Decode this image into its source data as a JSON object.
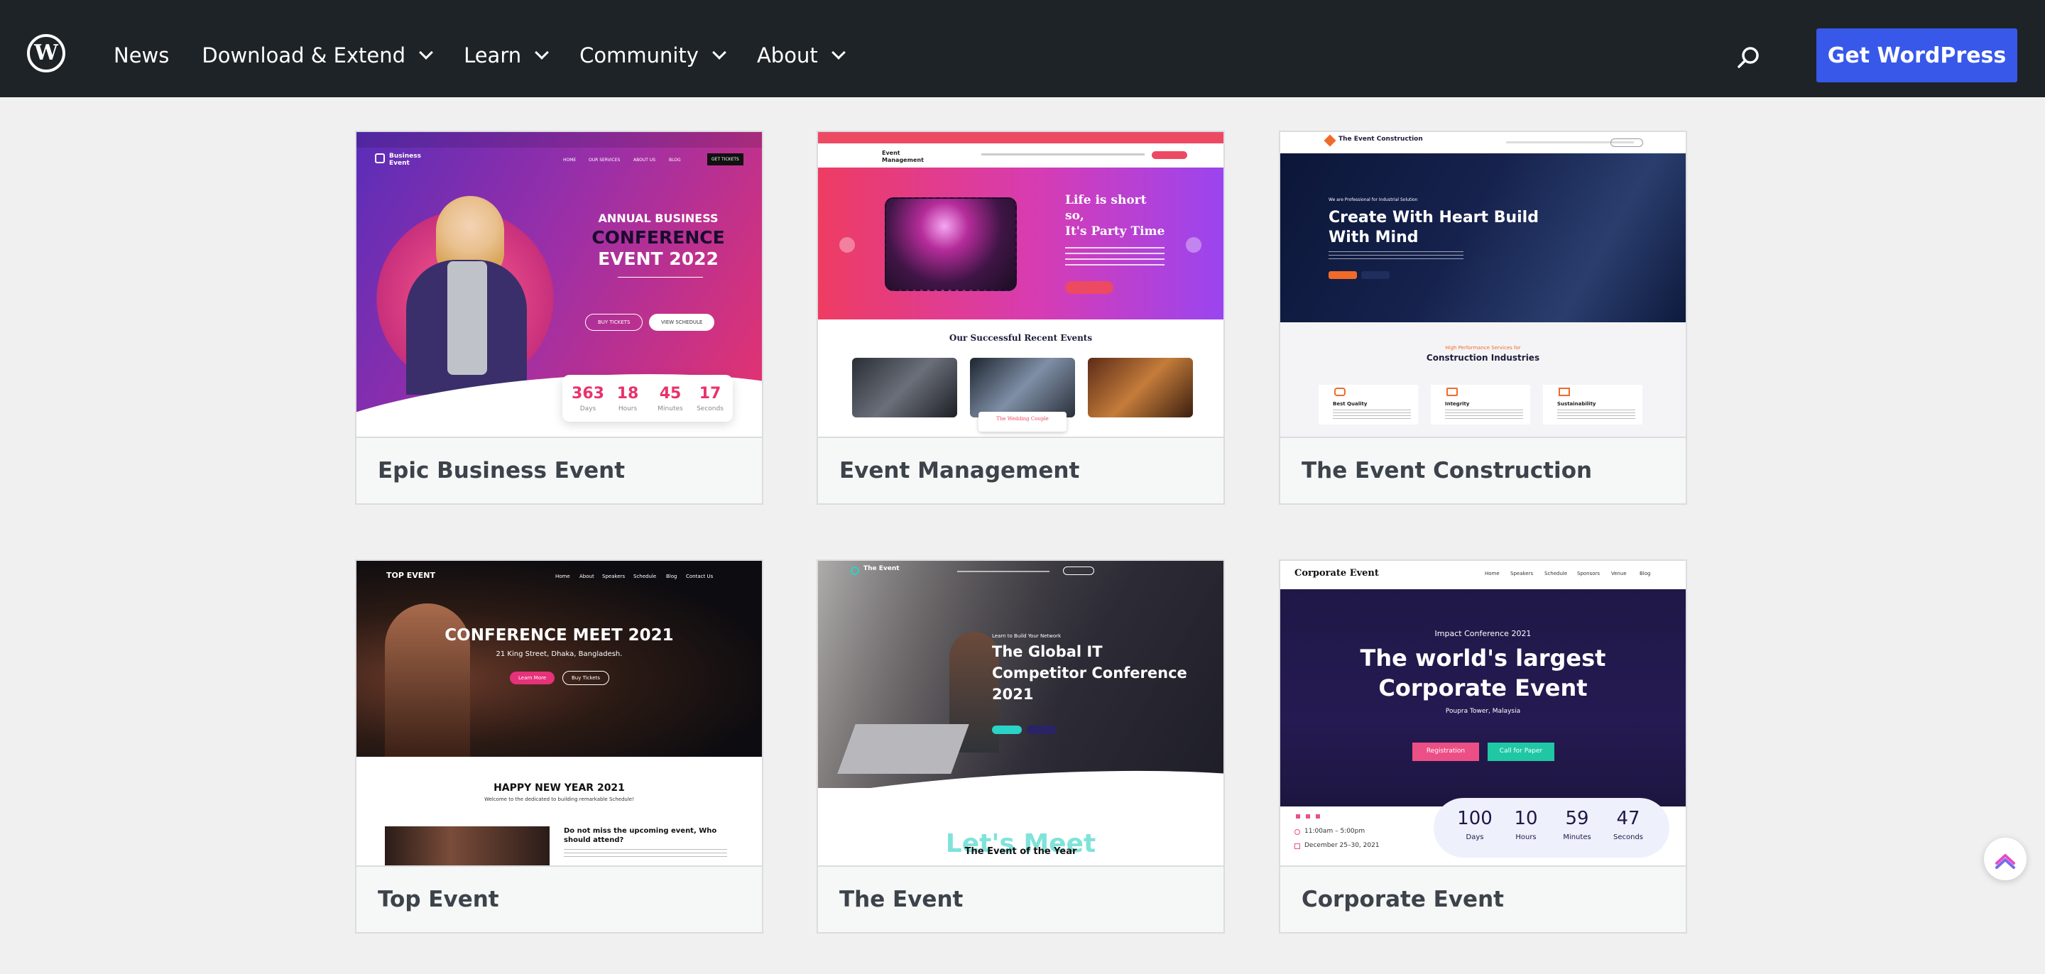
{
  "header": {
    "logo_letter": "W",
    "nav": [
      {
        "label": "News",
        "dropdown": false
      },
      {
        "label": "Download & Extend",
        "dropdown": true
      },
      {
        "label": "Learn",
        "dropdown": true
      },
      {
        "label": "Community",
        "dropdown": true
      },
      {
        "label": "About",
        "dropdown": true
      }
    ],
    "cta_label": "Get WordPress",
    "search_icon": "search-icon",
    "colors": {
      "bar": "#1d2327",
      "cta": "#3858e9"
    }
  },
  "cards": [
    {
      "title": "Epic Business Event",
      "preview": {
        "logo": "Business Event",
        "menu": [
          "HOME",
          "OUR SERVICES",
          "ABOUT US",
          "BLOG"
        ],
        "button": "GET TICKETS",
        "kicker": "ANNUAL BUSINESS",
        "headline": [
          "CONFERENCE",
          "EVENT 2022"
        ],
        "buttons": [
          "BUY TICKETS",
          "VIEW SCHEDULE"
        ],
        "countdown": [
          {
            "value": "363",
            "label": "Days"
          },
          {
            "value": "18",
            "label": "Hours"
          },
          {
            "value": "45",
            "label": "Minutes"
          },
          {
            "value": "17",
            "label": "Seconds"
          }
        ]
      }
    },
    {
      "title": "Event Management",
      "preview": {
        "logo": "Event Management",
        "headline": [
          "Life is short",
          "so,",
          "It's Party Time"
        ],
        "section_title": "Our Successful Recent Events",
        "caption": "The Wedding Couple"
      }
    },
    {
      "title": "The Event Construction",
      "preview": {
        "logo": "The Event Construction",
        "kicker": "We are Professional for Industrial Solution",
        "headline": [
          "Create With Heart Build",
          "With Mind"
        ],
        "section_kicker": "High Performance Services for",
        "section_title": "Construction Industries",
        "features": [
          "Best Quality",
          "Integrity",
          "Sustainability"
        ]
      }
    },
    {
      "title": "Top Event",
      "preview": {
        "logo": "TOP EVENT",
        "menu": [
          "Home",
          "About",
          "Speakers",
          "Schedule",
          "Blog",
          "Contact Us"
        ],
        "headline": "CONFERENCE MEET 2021",
        "address": "21 King Street, Dhaka, Bangladesh.",
        "buttons": [
          "Learn More",
          "Buy Tickets"
        ],
        "section_title": "HAPPY NEW YEAR 2021",
        "section_sub": "Welcome to the dedicated to building remarkable Schedule!",
        "blurb": "Do not miss the upcoming event, Who should attend?"
      }
    },
    {
      "title": "The Event",
      "preview": {
        "logo": "The Event",
        "kicker": "Learn to Build Your Network",
        "headline": [
          "The Global IT",
          "Competitor Conference",
          "2021"
        ],
        "watermark": "Let's Meet",
        "section_title": "The Event of the Year"
      }
    },
    {
      "title": "Corporate Event",
      "preview": {
        "logo": "Corporate Event",
        "menu": [
          "Home",
          "Speakers",
          "Schedule",
          "Sponsors",
          "Venue",
          "Blog"
        ],
        "kicker": "Impact Conference 2021",
        "headline": [
          "The world's largest",
          "Corporate Event"
        ],
        "location": "Poupra Tower, Malaysia",
        "buttons": [
          "Registration",
          "Call for Paper"
        ],
        "time": "11:00am – 5:00pm",
        "date": "December 25–30, 2021",
        "countdown": [
          {
            "value": "100",
            "label": "Days"
          },
          {
            "value": "10",
            "label": "Hours"
          },
          {
            "value": "59",
            "label": "Minutes"
          },
          {
            "value": "47",
            "label": "Seconds"
          }
        ]
      }
    }
  ]
}
